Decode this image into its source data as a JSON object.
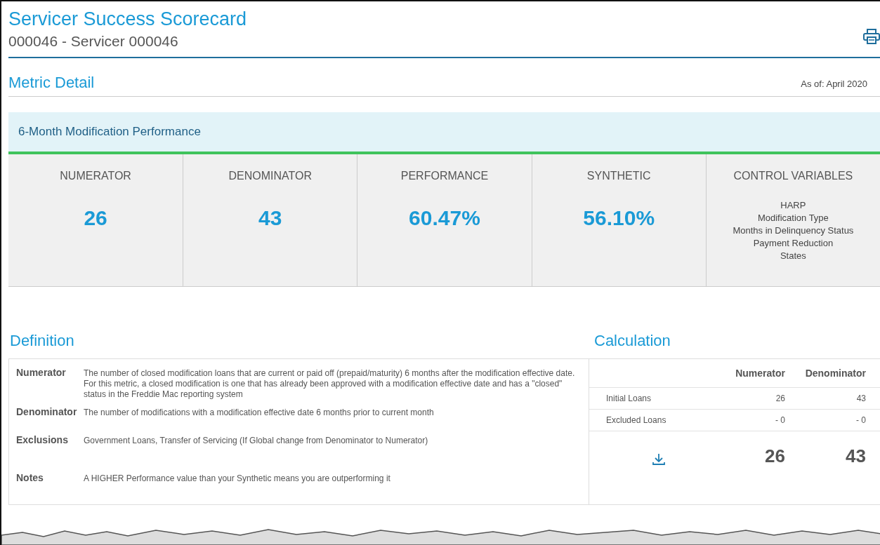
{
  "header": {
    "title": "Servicer Success Scorecard",
    "subtitle": "000046 - Servicer 000046"
  },
  "section": {
    "title": "Metric Detail",
    "as_of": "As of:  April 2020"
  },
  "metric": {
    "name": "6-Month Modification Performance"
  },
  "tiles": [
    {
      "kind": "value",
      "label": "NUMERATOR",
      "value": "26"
    },
    {
      "kind": "value",
      "label": "DENOMINATOR",
      "value": "43"
    },
    {
      "kind": "value",
      "label": "PERFORMANCE",
      "value": "60.47%"
    },
    {
      "kind": "value",
      "label": "SYNTHETIC",
      "value": "56.10%"
    },
    {
      "kind": "list",
      "label": "CONTROL VARIABLES",
      "items": [
        "HARP",
        "Modification Type",
        "Months in Delinquency Status",
        "Payment Reduction",
        "States"
      ]
    }
  ],
  "definition": {
    "title": "Definition",
    "rows": [
      {
        "term": "Numerator",
        "text": "The number of closed modification loans that are current or paid off (prepaid/maturity) 6 months after the modification effective date. For this metric, a closed modification is one that has already been approved with a modification effective date and has a \"closed\" status in the Freddie Mac reporting system"
      },
      {
        "term": "Denominator",
        "text": "The number of modifications with a modification effective date 6 months prior to current month"
      },
      {
        "term": "Exclusions",
        "text": "Government Loans, Transfer of Servicing (If Global change from Denominator to Numerator)"
      },
      {
        "term": "Notes",
        "text": "A HIGHER Performance value than your Synthetic means you are outperforming it"
      }
    ]
  },
  "calculation": {
    "title": "Calculation",
    "columns": [
      "Numerator",
      "Denominator"
    ],
    "rows": [
      {
        "label": "Initial Loans",
        "values": [
          "26",
          "43"
        ]
      },
      {
        "label": "Excluded Loans",
        "values": [
          "- 0",
          "- 0"
        ]
      }
    ],
    "totals": [
      "26",
      "43"
    ]
  }
}
